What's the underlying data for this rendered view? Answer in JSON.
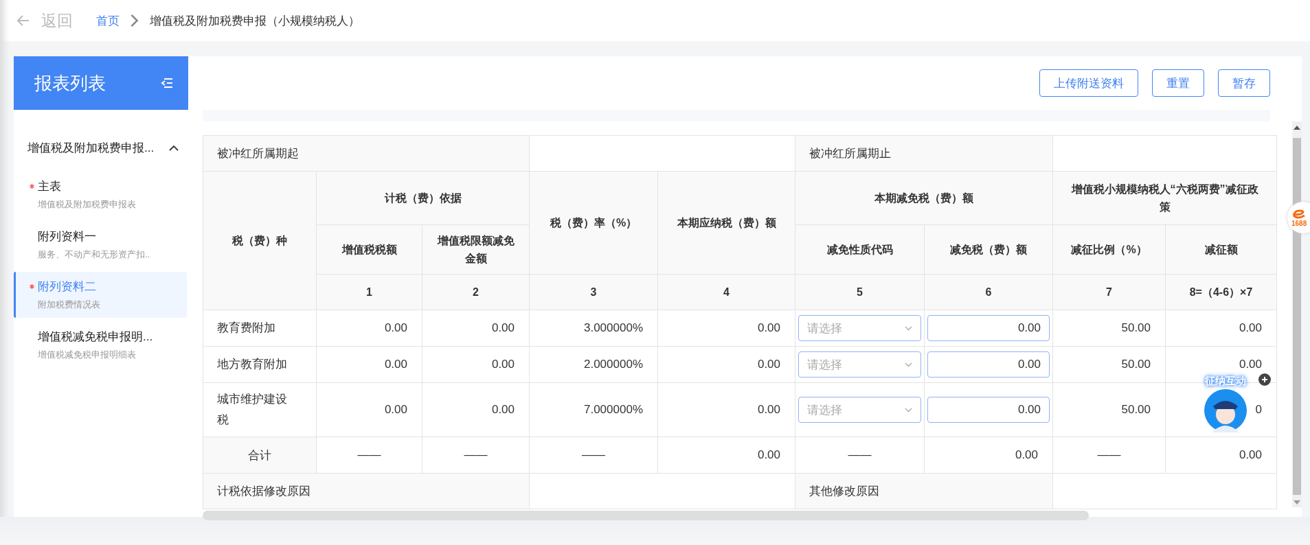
{
  "header": {
    "back_label": "返回",
    "breadcrumb": [
      {
        "label": "首页",
        "kind": "link"
      },
      {
        "label": "增值税及附加税费申报（小规模纳税人）",
        "kind": "current"
      }
    ]
  },
  "sidebar": {
    "title": "报表列表",
    "group": {
      "label": "增值税及附加税费申报...",
      "expanded": true,
      "items": [
        {
          "title": "主表",
          "subtitle": "增值税及附加税费申报表",
          "required": true,
          "selected": false
        },
        {
          "title": "附列资料一",
          "subtitle": "服务、不动产和无形资产扣..",
          "required": false,
          "selected": false
        },
        {
          "title": "附列资料二",
          "subtitle": "附加税费情况表",
          "required": true,
          "selected": true
        },
        {
          "title": "增值税减免税申报明...",
          "subtitle": "增值税减免税申报明细表",
          "required": false,
          "selected": false
        }
      ]
    }
  },
  "toolbar": {
    "buttons": [
      "上传附送资料",
      "重置",
      "暂存"
    ]
  },
  "table": {
    "period_row": {
      "start_label": "被冲红所属期起",
      "end_label": "被冲红所属期止"
    },
    "headers": {
      "tax_type": "税（费）种",
      "basis": "计税（费）依据",
      "vat_amount": "增值税税额",
      "vat_limit_relief": "增值税限额减免金额",
      "rate": "税（费）率（%）",
      "payable": "本期应纳税（费）额",
      "relief": "本期减免税（费）额",
      "relief_code": "减免性质代码",
      "relief_amount": "减免税（费）额",
      "policy": "增值税小规模纳税人“六税两费”减征政策",
      "reduction_ratio": "减征比例（%）",
      "reduction_amount": "减征额"
    },
    "column_numbers": [
      "1",
      "2",
      "3",
      "4",
      "5",
      "6",
      "7",
      "8=（4-6）×7"
    ],
    "rows": [
      {
        "name": "教育费附加",
        "vat_amount": "0.00",
        "vat_limit_relief": "0.00",
        "rate": "3.000000%",
        "payable": "0.00",
        "relief_code_placeholder": "请选择",
        "relief_amount": "0.00",
        "reduction_ratio": "50.00",
        "reduction_amount": "0.00"
      },
      {
        "name": "地方教育附加",
        "vat_amount": "0.00",
        "vat_limit_relief": "0.00",
        "rate": "2.000000%",
        "payable": "0.00",
        "relief_code_placeholder": "请选择",
        "relief_amount": "0.00",
        "reduction_ratio": "50.00",
        "reduction_amount": "0.00"
      },
      {
        "name": "城市维护建设税",
        "vat_amount": "0.00",
        "vat_limit_relief": "0.00",
        "rate": "7.000000%",
        "payable": "0.00",
        "relief_code_placeholder": "请选择",
        "relief_amount": "0.00",
        "reduction_ratio": "50.00",
        "reduction_amount": "0"
      }
    ],
    "total": {
      "label": "合计",
      "cells": [
        "——",
        "——",
        "——",
        "0.00",
        "——",
        "0.00",
        "——",
        "0.00"
      ]
    },
    "reason_row": {
      "basis_label": "计税依据修改原因",
      "other_label": "其他修改原因"
    }
  },
  "assistant": {
    "label": "征纳互动"
  },
  "side_badge": {
    "label": "1688"
  }
}
